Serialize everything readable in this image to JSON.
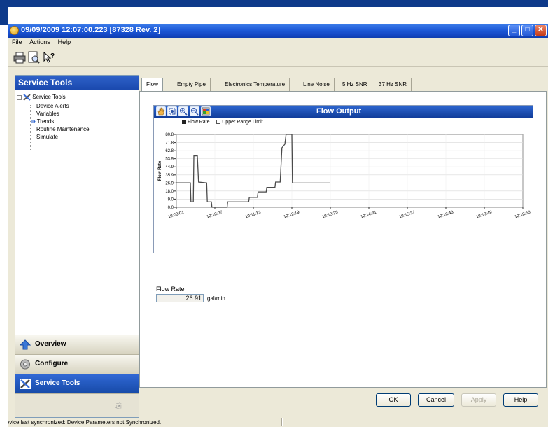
{
  "window": {
    "title": "09/09/2009 12:07:00.223 [87328 Rev. 2]",
    "minimize_glyph": "_",
    "maximize_glyph": "□",
    "close_glyph": "✕"
  },
  "menubar": {
    "items": [
      "File",
      "Actions",
      "Help"
    ]
  },
  "toolbar": {
    "icons": [
      "printer-icon",
      "print-preview-icon",
      "help-pointer-icon"
    ]
  },
  "sidebar": {
    "header": "Service Tools",
    "tree": {
      "root": "Service Tools",
      "root_expander": "−",
      "children": [
        "Device Alerts",
        "Variables",
        "Trends",
        "Routine Maintenance",
        "Simulate"
      ],
      "selected": "Trends",
      "selected_marker": "⇒"
    },
    "nav": {
      "overview": "Overview",
      "configure": "Configure",
      "service_tools": "Service Tools"
    },
    "footer_glyph": "⎘"
  },
  "tabs": [
    "Flow",
    "Empty Pipe",
    "Electronics Temperature",
    "Line Noise",
    "5 Hz SNR",
    "37 Hz SNR"
  ],
  "active_tab": "Flow",
  "chart_tools": [
    "hand-pan-icon",
    "zoom-box-icon",
    "zoom-in-icon",
    "zoom-out-icon",
    "palette-icon"
  ],
  "chart_data": {
    "type": "line",
    "title": "Flow Output",
    "ylabel": "Flow Rate",
    "xlabel": "",
    "legend": [
      "Flow Rate",
      "Upper Range Limit"
    ],
    "legend_placement": "top-left",
    "ylim": [
      0,
      80.8
    ],
    "yticks": [
      "80.8",
      "71.8",
      "62.8",
      "53.9",
      "44.9",
      "35.9",
      "26.9",
      "18.0",
      "9.0",
      "0.0"
    ],
    "xlim": [
      "10:09:01",
      "10:18:55"
    ],
    "xticks": [
      "10:09:01",
      "10:10:07",
      "10:11:13",
      "10:12:19",
      "10:13:25",
      "10:14:31",
      "10:15:37",
      "10:16:43",
      "10:17:49",
      "10:18:55"
    ],
    "grid": true,
    "series": [
      {
        "name": "Flow Rate",
        "color": "#4a4a4a",
        "points": [
          [
            "10:09:01",
            27
          ],
          [
            "10:09:25",
            27
          ],
          [
            "10:09:26",
            6
          ],
          [
            "10:09:30",
            6
          ],
          [
            "10:09:31",
            57
          ],
          [
            "10:09:37",
            57
          ],
          [
            "10:09:39",
            28
          ],
          [
            "10:09:53",
            27
          ],
          [
            "10:09:54",
            6
          ],
          [
            "10:10:01",
            6
          ],
          [
            "10:10:02",
            0
          ],
          [
            "10:10:28",
            0
          ],
          [
            "10:10:29",
            6
          ],
          [
            "10:11:05",
            6
          ],
          [
            "10:11:06",
            11
          ],
          [
            "10:11:20",
            11
          ],
          [
            "10:11:21",
            17
          ],
          [
            "10:11:35",
            17
          ],
          [
            "10:11:36",
            22
          ],
          [
            "10:11:50",
            22
          ],
          [
            "10:11:51",
            28
          ],
          [
            "10:11:59",
            28
          ],
          [
            "10:12:02",
            66
          ],
          [
            "10:12:07",
            70
          ],
          [
            "10:12:09",
            80.8
          ],
          [
            "10:12:19",
            80.8
          ],
          [
            "10:12:20",
            26.9
          ],
          [
            "10:12:23",
            26.9
          ],
          [
            "10:13:25",
            26.9
          ]
        ]
      }
    ]
  },
  "readout": {
    "label": "Flow Rate",
    "value": "26.91",
    "unit": "gal/min"
  },
  "buttons": {
    "ok": "OK",
    "cancel": "Cancel",
    "apply": "Apply",
    "help": "Help"
  },
  "statusbar": {
    "text": "Device last synchronized: Device Parameters not Synchronized."
  }
}
